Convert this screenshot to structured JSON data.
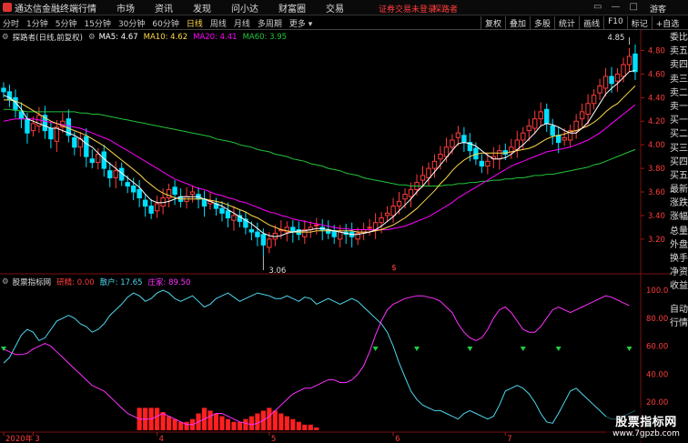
{
  "app": {
    "title": "通达信金融终端"
  },
  "menu": [
    "行情",
    "市场",
    "资讯",
    "发现",
    "问小达",
    "财富圈",
    "交易"
  ],
  "notice": {
    "left": "证券交易未登录",
    "right": "探路者"
  },
  "window": {
    "user": "游客"
  },
  "periods": [
    {
      "label": "分时"
    },
    {
      "label": "1分钟"
    },
    {
      "label": "5分钟"
    },
    {
      "label": "15分钟"
    },
    {
      "label": "30分钟"
    },
    {
      "label": "60分钟"
    },
    {
      "label": "日线"
    },
    {
      "label": "周线"
    },
    {
      "label": "月线"
    },
    {
      "label": "多周期"
    },
    {
      "label": "更多 ▾"
    }
  ],
  "toolbar": [
    "复权",
    "叠加",
    "多股",
    "统计",
    "画线",
    "F10",
    "标记",
    "+自选"
  ],
  "main_info": {
    "title": "探路者(日线,前复权)",
    "ma5": "MA5: 4.67",
    "ma10": "MA10: 4.62",
    "ma20": "MA20: 4.41",
    "ma60": "MA60: 3.95"
  },
  "ind_info": {
    "title": "股票指标网",
    "zhuli": "研精: 0.00",
    "sanhu": "散户: 17.65",
    "zhuangjia": "庄家: 89.50"
  },
  "right_list": [
    "委比",
    "卖五",
    "卖四",
    "卖三",
    "卖二",
    "卖一",
    "买一",
    "买二",
    "买三",
    "买四",
    "买五",
    "最新",
    "涨跌",
    "涨幅",
    "总量",
    "外盘",
    "换手",
    "净资",
    "收益"
  ],
  "right_list2": [
    "自动",
    "行情"
  ],
  "watermark": {
    "line1": "股票指标网",
    "line2": "www.7gpzb.com"
  },
  "colors": {
    "up": "#ff3c3c",
    "down": "#00e0ff",
    "ma5": "#ffffff",
    "ma10": "#ffd84a",
    "ma20": "#ff00ff",
    "ma60": "#22c43a",
    "sanhu": "#4fd7ee",
    "zhuangjia": "#ff30ff",
    "zhuli": "#ff2020",
    "arrow": "#22cc44"
  },
  "chart_data": [
    {
      "type": "candlestick",
      "title": "探路者(日线,前复权)",
      "ylim": [
        3.06,
        4.85
      ],
      "yticks": [
        3.2,
        3.4,
        3.6,
        3.8,
        4.0,
        4.2,
        4.4,
        4.6,
        4.8
      ],
      "ytick_labels": [
        "3.20",
        "3.40",
        "3.60",
        "3.80",
        "4.00",
        "4.20",
        "4.40",
        "4.60",
        "4.80"
      ],
      "x_month_labels": [
        {
          "i": 0,
          "label": "2020年"
        },
        {
          "i": 5,
          "label": "3"
        },
        {
          "i": 26,
          "label": "4"
        },
        {
          "i": 45,
          "label": "5"
        },
        {
          "i": 66,
          "label": "6"
        },
        {
          "i": 85,
          "label": "7"
        }
      ],
      "annotations": [
        {
          "i": 44,
          "price": 3.06,
          "label": "3.06"
        },
        {
          "i": 106,
          "price": 4.85,
          "label": "4.85"
        }
      ],
      "marker": {
        "i": 66,
        "label": "$"
      },
      "close": [
        4.45,
        4.38,
        4.3,
        4.22,
        4.1,
        4.18,
        4.25,
        4.12,
        4.05,
        4.15,
        4.2,
        4.08,
        3.98,
        4.05,
        3.9,
        3.85,
        3.92,
        3.8,
        3.72,
        3.78,
        3.7,
        3.65,
        3.6,
        3.55,
        3.48,
        3.42,
        3.5,
        3.55,
        3.62,
        3.58,
        3.52,
        3.56,
        3.6,
        3.54,
        3.48,
        3.52,
        3.46,
        3.42,
        3.38,
        3.4,
        3.35,
        3.3,
        3.26,
        3.22,
        3.15,
        3.2,
        3.25,
        3.28,
        3.3,
        3.26,
        3.24,
        3.28,
        3.3,
        3.32,
        3.28,
        3.25,
        3.22,
        3.26,
        3.24,
        3.22,
        3.25,
        3.28,
        3.3,
        3.34,
        3.38,
        3.42,
        3.48,
        3.52,
        3.58,
        3.62,
        3.68,
        3.74,
        3.8,
        3.86,
        3.92,
        3.98,
        4.04,
        4.1,
        4.02,
        3.95,
        3.88,
        3.82,
        3.86,
        3.9,
        3.95,
        3.92,
        3.98,
        4.04,
        4.1,
        4.16,
        4.22,
        4.28,
        4.18,
        4.08,
        4.02,
        4.06,
        4.12,
        4.2,
        4.28,
        4.35,
        4.42,
        4.5,
        4.58,
        4.52,
        4.6,
        4.68,
        4.75,
        4.62
      ],
      "ma5": [
        4.42,
        4.4,
        4.36,
        4.3,
        4.22,
        4.2,
        4.18,
        4.16,
        4.14,
        4.14,
        4.12,
        4.1,
        4.08,
        4.05,
        4.01,
        3.98,
        3.93,
        3.88,
        3.84,
        3.8,
        3.76,
        3.72,
        3.68,
        3.64,
        3.58,
        3.53,
        3.51,
        3.51,
        3.52,
        3.54,
        3.56,
        3.56,
        3.56,
        3.56,
        3.54,
        3.52,
        3.5,
        3.48,
        3.45,
        3.42,
        3.39,
        3.36,
        3.33,
        3.29,
        3.25,
        3.23,
        3.22,
        3.23,
        3.25,
        3.26,
        3.27,
        3.27,
        3.28,
        3.29,
        3.29,
        3.28,
        3.27,
        3.26,
        3.25,
        3.24,
        3.24,
        3.25,
        3.26,
        3.28,
        3.31,
        3.35,
        3.39,
        3.44,
        3.49,
        3.54,
        3.6,
        3.65,
        3.71,
        3.77,
        3.83,
        3.89,
        3.95,
        4.01,
        4.02,
        4.01,
        3.99,
        3.95,
        3.91,
        3.88,
        3.88,
        3.89,
        3.92,
        3.96,
        4.0,
        4.05,
        4.1,
        4.16,
        4.18,
        4.17,
        4.15,
        4.12,
        4.1,
        4.1,
        4.14,
        4.19,
        4.27,
        4.35,
        4.43,
        4.48,
        4.52,
        4.57,
        4.62,
        4.63
      ],
      "ma10": [
        4.38,
        4.38,
        4.37,
        4.35,
        4.32,
        4.29,
        4.26,
        4.23,
        4.2,
        4.18,
        4.16,
        4.14,
        4.12,
        4.1,
        4.08,
        4.05,
        4.02,
        3.99,
        3.95,
        3.91,
        3.87,
        3.83,
        3.79,
        3.75,
        3.7,
        3.66,
        3.62,
        3.59,
        3.57,
        3.55,
        3.54,
        3.54,
        3.54,
        3.54,
        3.54,
        3.53,
        3.52,
        3.51,
        3.49,
        3.47,
        3.45,
        3.43,
        3.4,
        3.38,
        3.35,
        3.32,
        3.3,
        3.28,
        3.27,
        3.26,
        3.26,
        3.26,
        3.26,
        3.27,
        3.27,
        3.27,
        3.27,
        3.27,
        3.27,
        3.27,
        3.26,
        3.26,
        3.26,
        3.27,
        3.28,
        3.3,
        3.32,
        3.35,
        3.38,
        3.42,
        3.46,
        3.51,
        3.56,
        3.61,
        3.67,
        3.72,
        3.78,
        3.83,
        3.87,
        3.9,
        3.92,
        3.93,
        3.93,
        3.93,
        3.93,
        3.93,
        3.94,
        3.95,
        3.96,
        3.97,
        3.99,
        4.02,
        4.05,
        4.07,
        4.08,
        4.09,
        4.11,
        4.12,
        4.14,
        4.16,
        4.19,
        4.23,
        4.28,
        4.32,
        4.35,
        4.4,
        4.45,
        4.5
      ],
      "ma20": [
        4.2,
        4.21,
        4.22,
        4.22,
        4.22,
        4.22,
        4.21,
        4.2,
        4.19,
        4.18,
        4.17,
        4.16,
        4.15,
        4.14,
        4.12,
        4.1,
        4.08,
        4.06,
        4.04,
        4.01,
        3.98,
        3.95,
        3.92,
        3.89,
        3.86,
        3.83,
        3.8,
        3.77,
        3.74,
        3.71,
        3.69,
        3.67,
        3.65,
        3.63,
        3.62,
        3.6,
        3.58,
        3.57,
        3.55,
        3.54,
        3.52,
        3.51,
        3.49,
        3.47,
        3.45,
        3.43,
        3.42,
        3.4,
        3.39,
        3.37,
        3.36,
        3.35,
        3.34,
        3.33,
        3.32,
        3.31,
        3.3,
        3.29,
        3.29,
        3.28,
        3.28,
        3.28,
        3.28,
        3.28,
        3.28,
        3.28,
        3.29,
        3.3,
        3.31,
        3.33,
        3.35,
        3.37,
        3.39,
        3.42,
        3.45,
        3.48,
        3.51,
        3.55,
        3.58,
        3.61,
        3.64,
        3.67,
        3.7,
        3.73,
        3.76,
        3.79,
        3.82,
        3.84,
        3.86,
        3.88,
        3.9,
        3.92,
        3.94,
        3.95,
        3.96,
        3.97,
        3.98,
        4.0,
        4.02,
        4.04,
        4.07,
        4.1,
        4.14,
        4.18,
        4.22,
        4.26,
        4.3,
        4.34
      ],
      "ma60": [
        4.3,
        4.3,
        4.29,
        4.29,
        4.28,
        4.28,
        4.28,
        4.28,
        4.28,
        4.28,
        4.28,
        4.28,
        4.28,
        4.27,
        4.27,
        4.26,
        4.26,
        4.25,
        4.24,
        4.23,
        4.22,
        4.21,
        4.2,
        4.19,
        4.18,
        4.17,
        4.16,
        4.15,
        4.14,
        4.13,
        4.12,
        4.11,
        4.1,
        4.09,
        4.08,
        4.07,
        4.05,
        4.04,
        4.03,
        4.02,
        4.0,
        3.99,
        3.98,
        3.96,
        3.95,
        3.94,
        3.92,
        3.91,
        3.9,
        3.88,
        3.87,
        3.86,
        3.84,
        3.83,
        3.82,
        3.8,
        3.79,
        3.78,
        3.76,
        3.75,
        3.74,
        3.72,
        3.71,
        3.7,
        3.69,
        3.68,
        3.67,
        3.66,
        3.66,
        3.65,
        3.65,
        3.65,
        3.65,
        3.65,
        3.65,
        3.66,
        3.66,
        3.67,
        3.67,
        3.68,
        3.68,
        3.69,
        3.69,
        3.7,
        3.7,
        3.71,
        3.71,
        3.72,
        3.72,
        3.73,
        3.74,
        3.74,
        3.75,
        3.75,
        3.76,
        3.77,
        3.78,
        3.79,
        3.8,
        3.81,
        3.83,
        3.84,
        3.86,
        3.88,
        3.9,
        3.92,
        3.94,
        3.96
      ]
    },
    {
      "type": "line",
      "title": "股票指标网",
      "ylim": [
        0,
        100
      ],
      "yticks": [
        20,
        40,
        60,
        80,
        100
      ],
      "ytick_labels": [
        "20.00",
        "40.00",
        "60.00",
        "80.00",
        "100.0"
      ],
      "series": [
        {
          "name": "散户",
          "values": [
            48,
            52,
            60,
            68,
            72,
            70,
            64,
            66,
            72,
            78,
            80,
            82,
            80,
            76,
            74,
            70,
            72,
            76,
            82,
            86,
            90,
            95,
            98,
            96,
            92,
            94,
            98,
            100,
            98,
            94,
            92,
            94,
            96,
            92,
            88,
            90,
            94,
            96,
            98,
            95,
            92,
            94,
            96,
            98,
            97,
            96,
            94,
            94,
            96,
            94,
            92,
            95,
            94,
            90,
            92,
            94,
            92,
            90,
            92,
            94,
            92,
            88,
            84,
            80,
            76,
            70,
            60,
            48,
            38,
            28,
            22,
            18,
            16,
            14,
            14,
            12,
            10,
            8,
            12,
            14,
            12,
            10,
            8,
            10,
            18,
            28,
            30,
            32,
            30,
            26,
            20,
            12,
            6,
            5,
            12,
            20,
            28,
            30,
            26,
            22,
            18,
            14,
            10,
            8,
            8,
            10,
            12,
            14
          ]
        },
        {
          "name": "庄家",
          "values": [
            58,
            56,
            54,
            54,
            55,
            58,
            60,
            62,
            60,
            56,
            52,
            48,
            44,
            40,
            36,
            32,
            30,
            28,
            24,
            20,
            16,
            12,
            10,
            8,
            8,
            8,
            10,
            12,
            10,
            8,
            6,
            4,
            4,
            6,
            8,
            10,
            12,
            12,
            10,
            8,
            6,
            5,
            4,
            5,
            7,
            10,
            14,
            18,
            22,
            26,
            28,
            30,
            30,
            32,
            34,
            36,
            36,
            34,
            34,
            36,
            40,
            46,
            56,
            68,
            78,
            86,
            90,
            92,
            94,
            95,
            96,
            96,
            95,
            94,
            92,
            88,
            84,
            76,
            70,
            66,
            64,
            66,
            72,
            80,
            86,
            88,
            84,
            78,
            72,
            70,
            70,
            74,
            80,
            86,
            88,
            86,
            84,
            86,
            88,
            90,
            92,
            94,
            96,
            95,
            93,
            91,
            89
          ]
        },
        {
          "name": "研精",
          "values": [
            0,
            0,
            0,
            0,
            0,
            0,
            0,
            0,
            0,
            0,
            0,
            0,
            0,
            0,
            0,
            0,
            0,
            0,
            0,
            0,
            0,
            0,
            0,
            16,
            16,
            16,
            16,
            13,
            10,
            8,
            6,
            6,
            8,
            12,
            16,
            14,
            12,
            10,
            8,
            6,
            6,
            8,
            10,
            12,
            14,
            16,
            14,
            12,
            10,
            8,
            6,
            4,
            4,
            2,
            0,
            0,
            0,
            0,
            0,
            0,
            0,
            0,
            0,
            0,
            0,
            0,
            0,
            0,
            0,
            0,
            0,
            0,
            0,
            0,
            0,
            0,
            0,
            0,
            0,
            0,
            0,
            0,
            0,
            0,
            0,
            0,
            0,
            0,
            0,
            0,
            0,
            0,
            0,
            0,
            0,
            0,
            0,
            0,
            0,
            0,
            0,
            0,
            0,
            0,
            0,
            0,
            0,
            0
          ]
        }
      ],
      "buy_arrows_at": [
        0,
        63,
        70,
        79,
        88,
        94,
        106
      ]
    }
  ]
}
